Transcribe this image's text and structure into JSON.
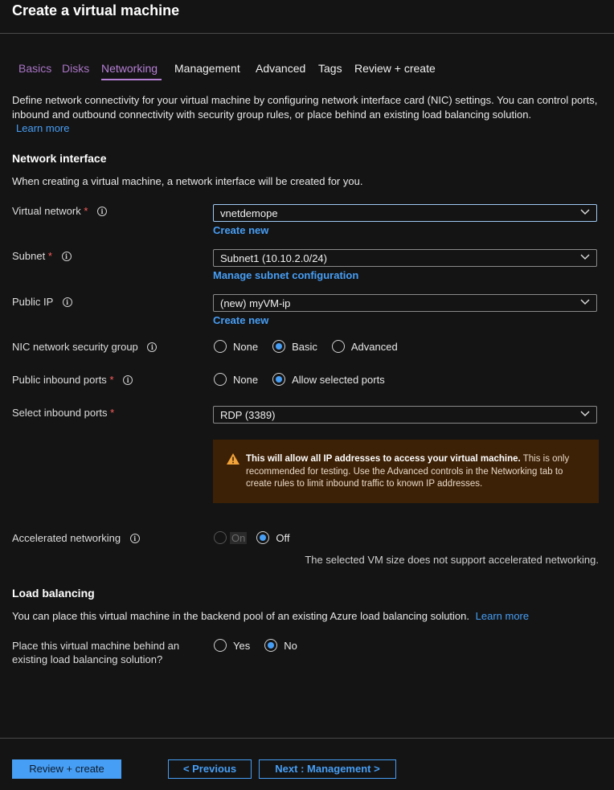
{
  "page": {
    "title": "Create a virtual machine"
  },
  "tabs": [
    {
      "label": "Basics",
      "state": "visited"
    },
    {
      "label": "Disks",
      "state": "visited"
    },
    {
      "label": "Networking",
      "state": "active"
    },
    {
      "label": "Management",
      "state": "default"
    },
    {
      "label": "Advanced",
      "state": "default"
    },
    {
      "label": "Tags",
      "state": "default"
    },
    {
      "label": "Review + create",
      "state": "default"
    }
  ],
  "intro": {
    "text": "Define network connectivity for your virtual machine by configuring network interface card (NIC) settings. You can control ports, inbound and outbound connectivity with security group rules, or place behind an existing load balancing solution.",
    "learn_more": "Learn more"
  },
  "network_interface": {
    "heading": "Network interface",
    "description": "When creating a virtual machine, a network interface will be created for you.",
    "virtual_network": {
      "label": "Virtual network",
      "required": "*",
      "value": "vnetdemope",
      "link": "Create new"
    },
    "subnet": {
      "label": "Subnet",
      "required": "*",
      "value": "Subnet1 (10.10.2.0/24)",
      "link": "Manage subnet configuration"
    },
    "public_ip": {
      "label": "Public IP",
      "value": "(new) myVM-ip",
      "link": "Create new"
    },
    "nsg": {
      "label": "NIC network security group",
      "options": [
        "None",
        "Basic",
        "Advanced"
      ],
      "selected": "Basic"
    },
    "public_inbound": {
      "label": "Public inbound ports",
      "required": "*",
      "options": [
        "None",
        "Allow selected ports"
      ],
      "selected": "Allow selected ports"
    },
    "select_inbound": {
      "label": "Select inbound ports",
      "required": "*",
      "value": "RDP (3389)"
    },
    "warning": {
      "bold": "This will allow all IP addresses to access your virtual machine.",
      "text": " This is only recommended for testing.  Use the Advanced controls in the Networking tab to create rules to limit inbound traffic to known IP addresses."
    },
    "accelerated": {
      "label": "Accelerated networking",
      "options": [
        "On",
        "Off"
      ],
      "selected": "Off",
      "note": "The selected VM size does not support accelerated networking."
    }
  },
  "load_balancing": {
    "heading": "Load balancing",
    "description": "You can place this virtual machine in the backend pool of an existing Azure load balancing solution.",
    "learn_more": "Learn more",
    "question_line1": "Place this virtual machine behind an",
    "question_line2": "existing load balancing solution?",
    "options": [
      "Yes",
      "No"
    ],
    "selected": "No"
  },
  "footer": {
    "review_create": "Review + create",
    "previous": "< Previous",
    "next": "Next : Management >"
  },
  "colors": {
    "accent": "#479ef5",
    "tab_active": "#b67fd6",
    "warning_bg": "#3d2106",
    "required": "#ff5c5c"
  }
}
